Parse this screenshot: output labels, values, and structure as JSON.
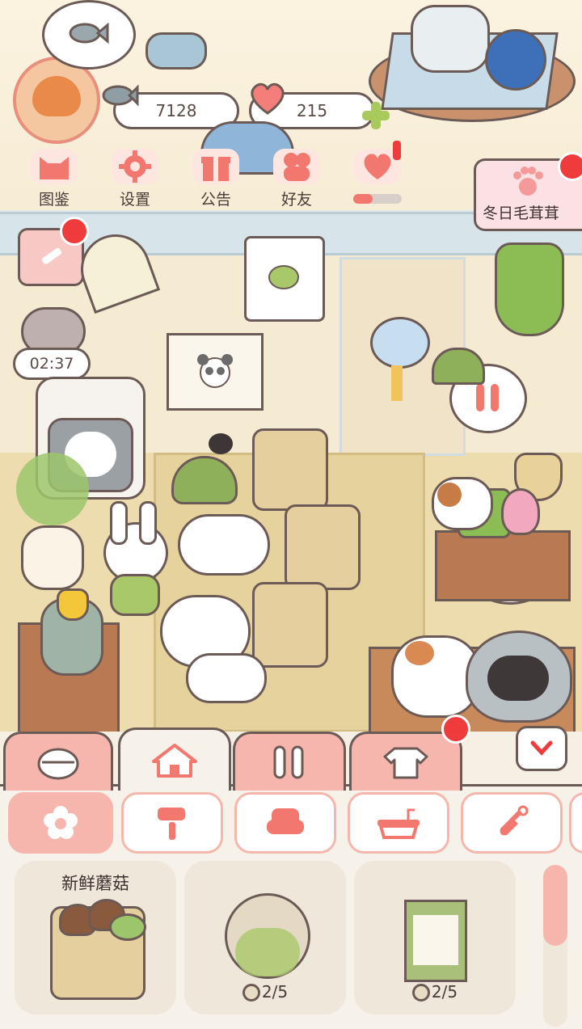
{
  "hud": {
    "fish_count": "7128",
    "heart_count": "215"
  },
  "menu": [
    {
      "label": "图鉴",
      "icon": "cat-face-icon"
    },
    {
      "label": "设置",
      "icon": "gear-icon"
    },
    {
      "label": "公告",
      "icon": "gift-icon"
    },
    {
      "label": "好友",
      "icon": "friends-icon"
    },
    {
      "label": "",
      "icon": "love-letter-icon"
    }
  ],
  "event_banner": {
    "label": "冬日毛茸茸",
    "icon": "paw-icon"
  },
  "timer": {
    "value": "02:37"
  },
  "tabs": [
    {
      "icon": "bowl-icon",
      "active": false
    },
    {
      "icon": "house-icon",
      "active": true
    },
    {
      "icon": "fork-knife-icon",
      "active": false
    },
    {
      "icon": "shirt-icon",
      "active": false
    }
  ],
  "filters": [
    {
      "icon": "flower-icon",
      "active": true
    },
    {
      "icon": "paint-roller-icon"
    },
    {
      "icon": "armchair-icon"
    },
    {
      "icon": "bathtub-icon"
    },
    {
      "icon": "shovel-icon"
    }
  ],
  "items": [
    {
      "name": "新鲜蘑菇",
      "cost": ""
    },
    {
      "name": "",
      "cost": "2/5"
    },
    {
      "name": "",
      "cost": "2/5"
    }
  ],
  "colors": {
    "tab_pink": "#f7b6ad",
    "accent_red": "#ef3b3b",
    "outline": "#6b5a55"
  }
}
